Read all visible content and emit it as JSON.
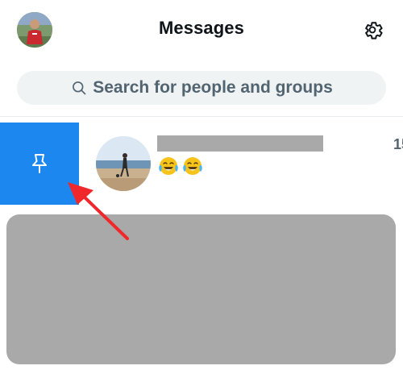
{
  "header": {
    "title": "Messages",
    "avatar_icon": "user-avatar",
    "settings_icon": "gear-icon"
  },
  "search": {
    "placeholder": "Search for people and groups",
    "icon": "search-icon"
  },
  "pin_action": {
    "icon": "pin-icon",
    "color": "#1d87f0"
  },
  "conversation": {
    "time": "15",
    "preview_emojis": [
      "face-with-tears-of-joy",
      "face-with-tears-of-joy"
    ]
  },
  "annotation": {
    "arrow_color": "#f0282b"
  },
  "colors": {
    "text_primary": "#0f1419",
    "text_secondary": "#536471",
    "search_bg": "#eff3f4",
    "redacted": "#a9a9a9"
  }
}
